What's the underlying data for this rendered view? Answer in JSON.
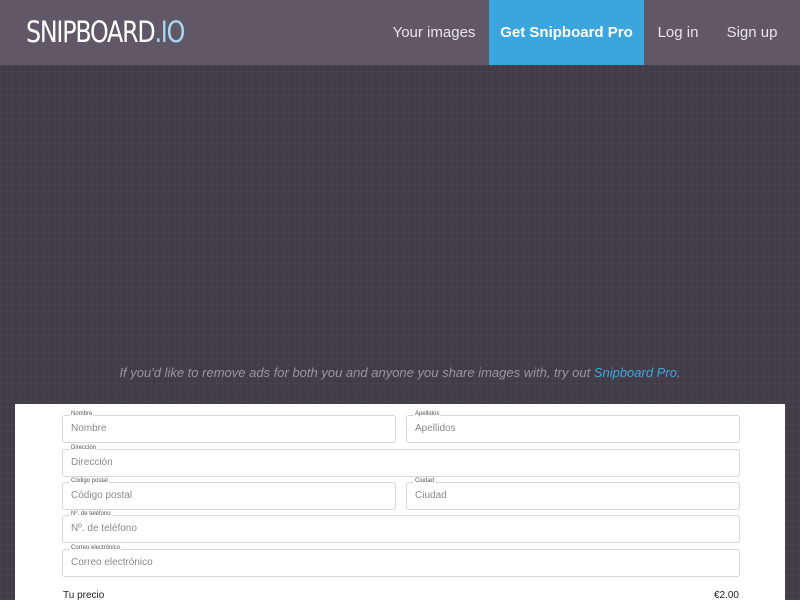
{
  "nav": {
    "logo_main": "SNIPBOARD",
    "logo_suffix": ".IO",
    "links": [
      "Your images",
      "Get Snipboard Pro",
      "Log in",
      "Sign up"
    ]
  },
  "promo": {
    "text": "If you'd like to remove ads for both you and anyone you share images with, try out ",
    "link": "Snipboard Pro",
    "end": "."
  },
  "form": {
    "nombre": {
      "label": "Nombre",
      "placeholder": "Nombre"
    },
    "apellidos": {
      "label": "Apellidos",
      "placeholder": "Apellidos"
    },
    "direccion": {
      "label": "Dirección",
      "placeholder": "Dirección"
    },
    "codigo_postal": {
      "label": "Código postal",
      "placeholder": "Código postal"
    },
    "ciudad": {
      "label": "Ciudad",
      "placeholder": "Ciudad"
    },
    "telefono": {
      "label": "Nº. de teléfono",
      "placeholder": "Nº. de teléfono"
    },
    "correo": {
      "label": "Correo electrónico",
      "placeholder": "Correo electrónico"
    },
    "price_label": "Tu precio",
    "price_value": "€2.00"
  },
  "colors": {
    "navbar": "#615867",
    "background": "#423c49",
    "accent": "#3ba6de"
  }
}
